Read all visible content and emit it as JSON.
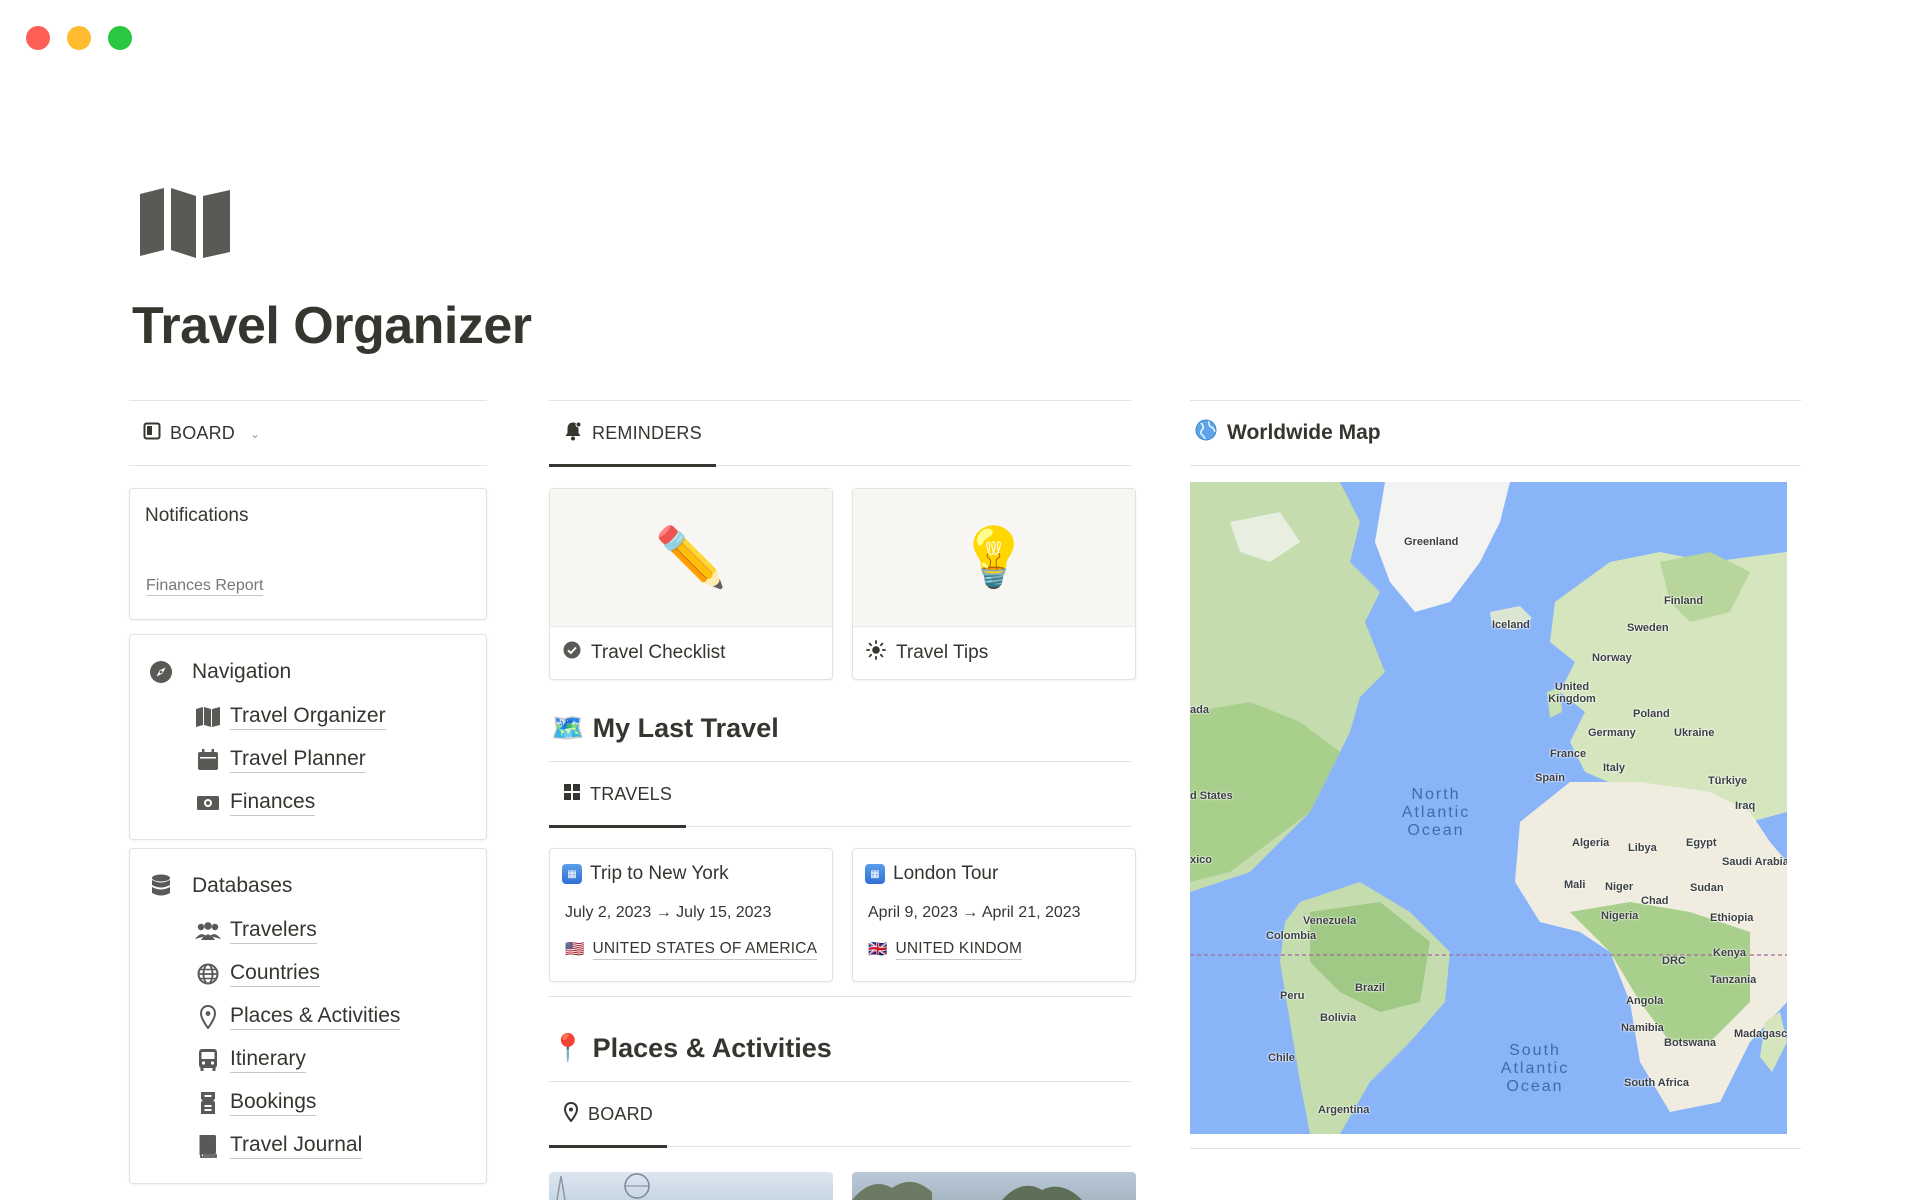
{
  "page": {
    "title": "Travel Organizer",
    "icon": "map-icon"
  },
  "left": {
    "board_tab": {
      "label": "BOARD",
      "icon": "board-icon"
    },
    "notifications": {
      "title": "Notifications",
      "link": "Finances Report"
    },
    "navigation": {
      "title": "Navigation",
      "icon": "compass-icon",
      "items": [
        {
          "label": "Travel Organizer",
          "icon": "map-icon"
        },
        {
          "label": "Travel Planner",
          "icon": "calendar-icon"
        },
        {
          "label": "Finances",
          "icon": "money-icon"
        }
      ]
    },
    "databases": {
      "title": "Databases",
      "icon": "database-icon",
      "items": [
        {
          "label": "Travelers",
          "icon": "people-icon"
        },
        {
          "label": "Countries",
          "icon": "globe-icon"
        },
        {
          "label": "Places & Activities",
          "icon": "pin-icon"
        },
        {
          "label": "Itinerary",
          "icon": "bus-icon"
        },
        {
          "label": "Bookings",
          "icon": "ticket-icon"
        },
        {
          "label": "Travel Journal",
          "icon": "book-icon"
        }
      ]
    }
  },
  "middle": {
    "reminders_tab": {
      "label": "REMINDERS",
      "icon": "bell-icon"
    },
    "reminders": [
      {
        "title": "Travel Checklist",
        "cover": "✏️",
        "icon": "check-circle-icon"
      },
      {
        "title": "Travel Tips",
        "cover": "💡",
        "icon": "sun-icon"
      }
    ],
    "last_travel": {
      "heading": "My Last Travel",
      "emoji": "🗺️"
    },
    "travels_tab": {
      "label": "TRAVELS",
      "icon": "grid-icon"
    },
    "travels": [
      {
        "title": "Trip to New York",
        "dates": "July 2, 2023 → July 15, 2023",
        "flag": "🇺🇸",
        "country": "UNITED STATES OF AMERICA"
      },
      {
        "title": "London Tour",
        "dates": "April 9, 2023 → April 21, 2023",
        "flag": "🇬🇧",
        "country": "UNITED KINDOM"
      }
    ],
    "places": {
      "heading": "Places & Activities",
      "emoji": "📍"
    },
    "places_tab": {
      "label": "BOARD",
      "icon": "pin-icon"
    }
  },
  "right": {
    "map": {
      "title": "Worldwide Map",
      "icon": "globe-icon",
      "labels": [
        "Greenland",
        "Iceland",
        "Finland",
        "Sweden",
        "Norway",
        "United Kingdom",
        "Poland",
        "Germany",
        "Ukraine",
        "France",
        "Italy",
        "Spain",
        "Türkiye",
        "Iraq",
        "Algeria",
        "Libya",
        "Egypt",
        "Saudi Arabia",
        "Mali",
        "Niger",
        "Chad",
        "Sudan",
        "Nigeria",
        "Ethiopia",
        "Venezuela",
        "Colombia",
        "Kenya",
        "DRC",
        "Tanzania",
        "Brazil",
        "Peru",
        "Bolivia",
        "Angola",
        "Namibia",
        "Botswana",
        "Madagascar",
        "Chile",
        "South Africa",
        "Argentina",
        "ada",
        "d States",
        "xico"
      ],
      "oceans": [
        "North Atlantic Ocean",
        "South Atlantic Ocean"
      ]
    }
  }
}
